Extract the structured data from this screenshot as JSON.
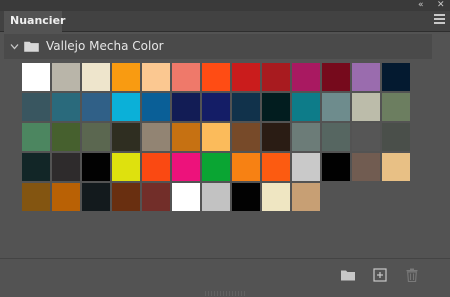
{
  "panel": {
    "tab_title": "Nuancier",
    "group_name": "Vallejo Mecha Color"
  },
  "icons": {
    "collapse": "double-chevron-left-icon",
    "close": "close-icon",
    "menu": "hamburger-menu-icon",
    "group_toggle": "chevron-down-icon",
    "group_folder": "folder-icon",
    "new_group": "folder-icon",
    "new_swatch": "new-swatch-icon",
    "delete": "trash-icon"
  },
  "swatches": [
    [
      "#ffffff",
      "#b9b5a9",
      "#eee5cc",
      "#f99b11",
      "#fbc891",
      "#ef796a",
      "#ff4c14",
      "#ca1c1c",
      "#a81b1f",
      "#a91961",
      "#760a1c",
      "#9a6cae",
      "#041a30"
    ],
    [
      "#395660",
      "#2a6a7c",
      "#306087",
      "#0bb0d8",
      "#0a5f97",
      "#121c55",
      "#141d66",
      "#11324b",
      "#021d1f",
      "#0d7c89",
      "#6e8c8d",
      "#bcbcaa",
      "#6c7e60"
    ],
    [
      "#4c8660",
      "#46602e",
      "#5b6750",
      "#2f2e21",
      "#928473",
      "#c67112",
      "#fbbb5b",
      "#774a29",
      "#2a1c14",
      "#6c7c78",
      "#566661",
      "#565656",
      "#4a4f4a"
    ],
    [
      "#122627",
      "#2e2b2c",
      "#020202",
      "#dee10e",
      "#fa4912",
      "#ed127b",
      "#0aa533",
      "#f78113",
      "#fc5b11",
      "#c9c9c9",
      "#010101",
      "#715c51",
      "#e8c085"
    ],
    [
      "#835511",
      "#b96105",
      "#131a1d",
      "#692f10",
      "#722e29",
      "#ffffff",
      "#c2c2c2",
      "#020202",
      "#efe6c2",
      "#c79f74"
    ]
  ]
}
